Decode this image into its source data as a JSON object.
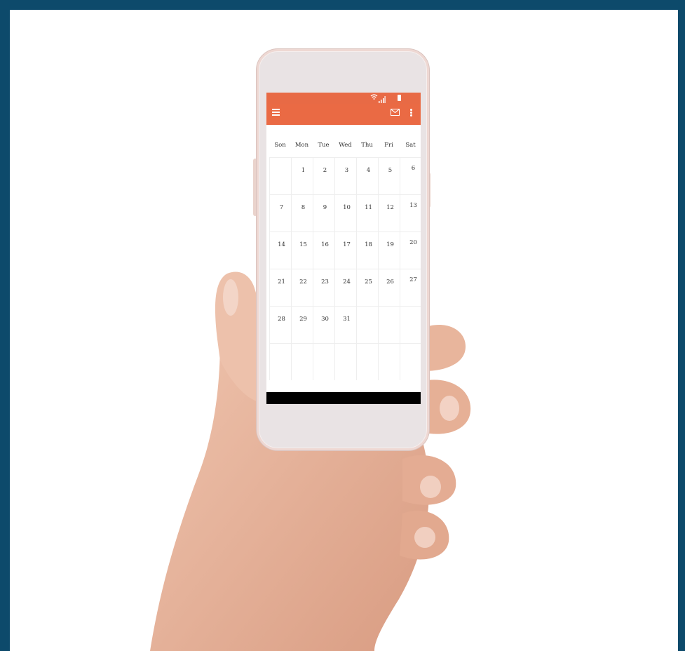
{
  "colors": {
    "border": "#0d4a6b",
    "app_bar": "#ea6a44",
    "nav_bar": "#000000"
  },
  "icons": [
    "wifi-icon",
    "signal-icon",
    "battery-icon",
    "menu-icon",
    "mail-icon",
    "more-vert-icon"
  ],
  "calendar": {
    "weekdays": [
      "Son",
      "Mon",
      "Tue",
      "Wed",
      "Thu",
      "Fri",
      "Sat"
    ],
    "weeks": [
      [
        "",
        "1",
        "2",
        "3",
        "4",
        "5",
        "6"
      ],
      [
        "7",
        "8",
        "9",
        "10",
        "11",
        "12",
        "13"
      ],
      [
        "14",
        "15",
        "16",
        "17",
        "18",
        "19",
        "20"
      ],
      [
        "21",
        "22",
        "23",
        "24",
        "25",
        "26",
        "27"
      ],
      [
        "28",
        "29",
        "30",
        "31",
        "",
        "",
        ""
      ],
      [
        "",
        "",
        "",
        "",
        "",
        "",
        ""
      ]
    ]
  }
}
